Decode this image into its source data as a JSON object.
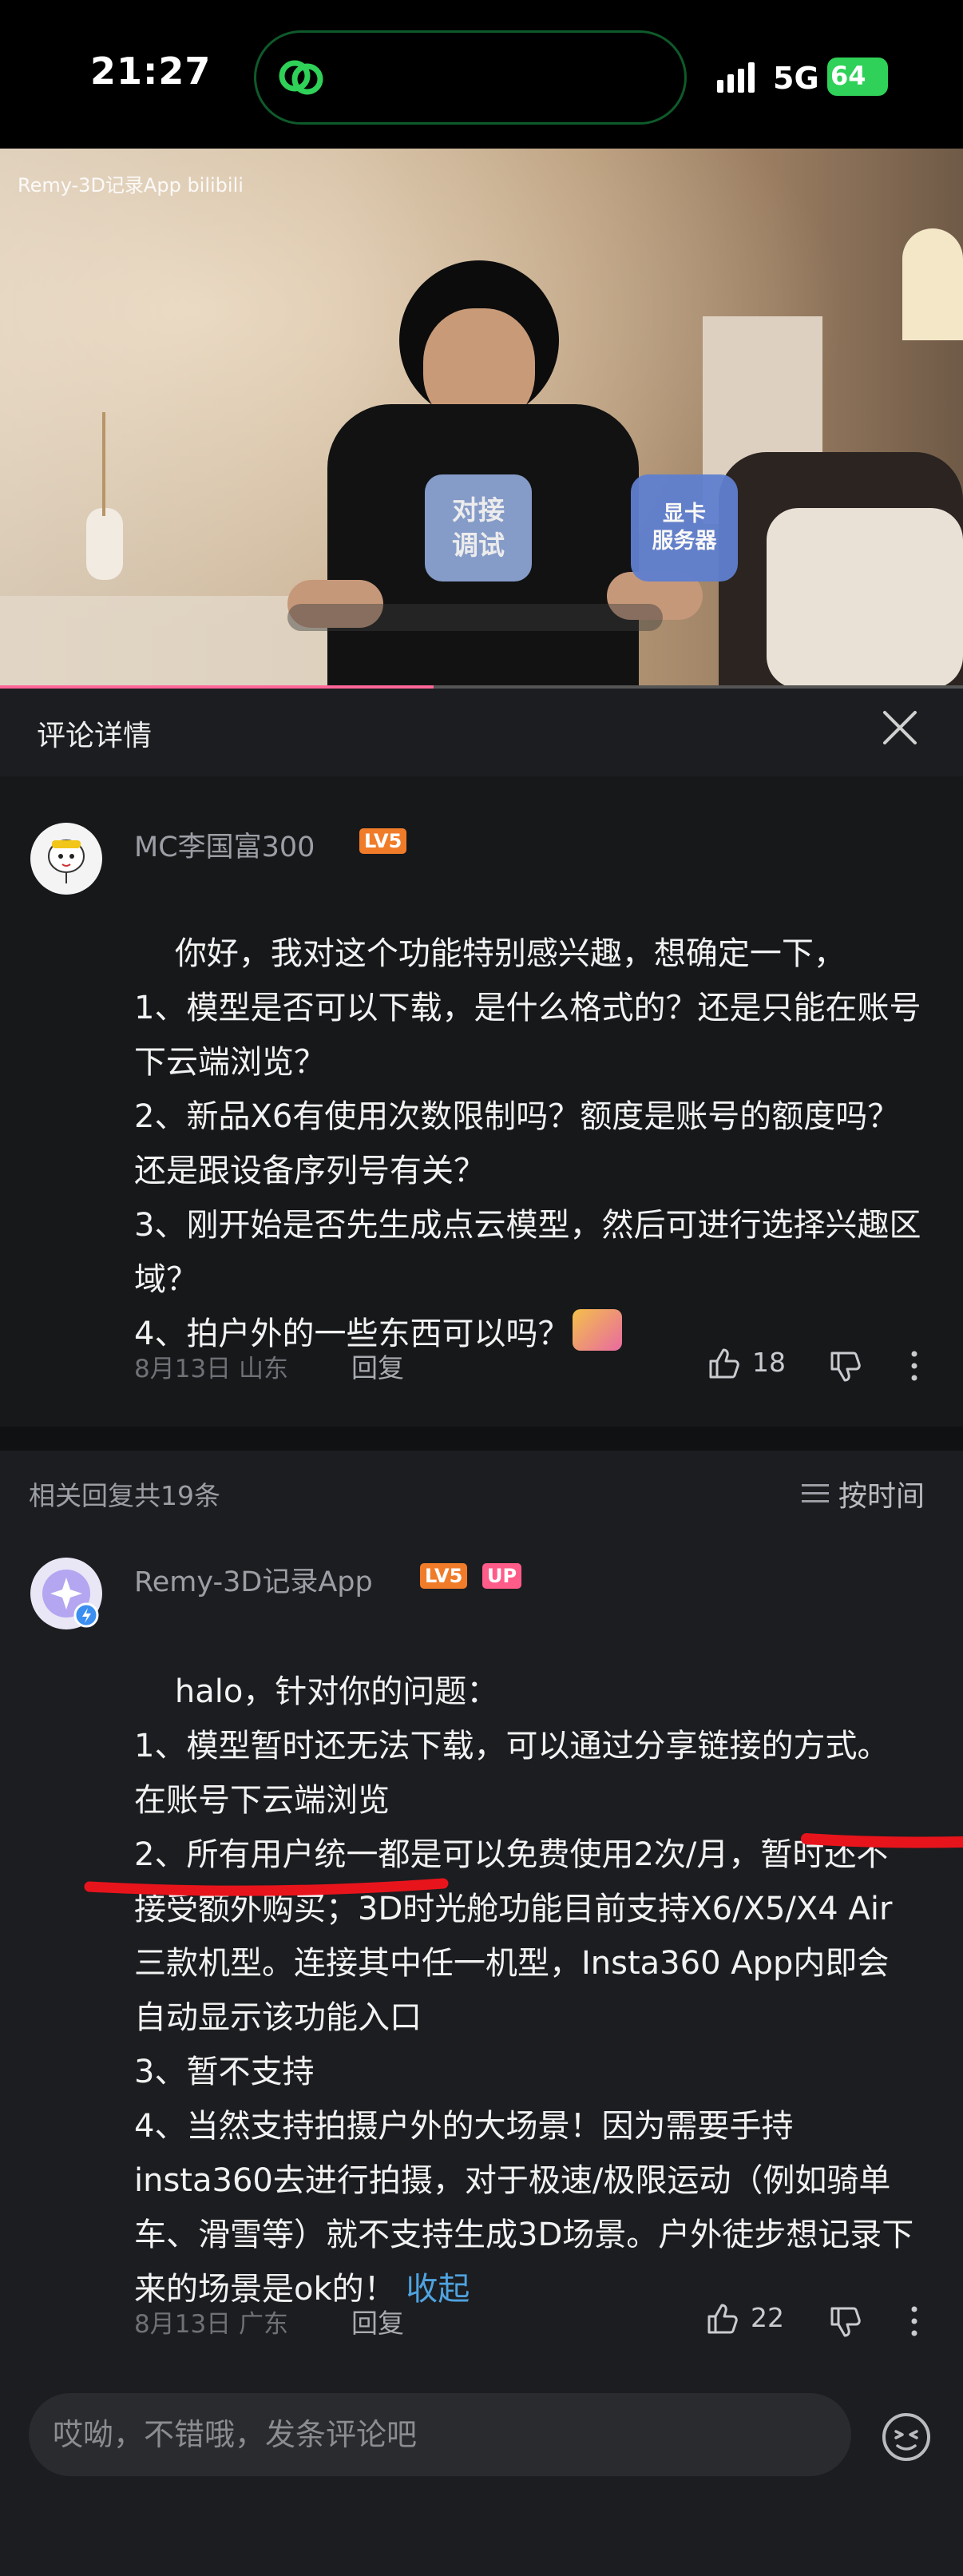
{
  "status": {
    "time": "21:27",
    "network": "5G",
    "battery": "64"
  },
  "video": {
    "watermark": "Remy-3D记录App bilibili",
    "chip1": "对接\n调试",
    "chip2": "显卡\n服务器",
    "progress_percent": 45
  },
  "panel": {
    "title": "评论详情"
  },
  "comment": {
    "username": "MC李国富300",
    "level": "LV5",
    "text": "你好，我对这个功能特别感兴趣，想确定一下，\n1、模型是否可以下载，是什么格式的？还是只能在账号下云端浏览？\n2、新品X6有使用次数限制吗？额度是账号的额度吗？还是跟设备序列号有关？\n3、刚开始是否先生成点云模型，然后可进行选择兴趣区域？\n4、拍户外的一些东西可以吗？",
    "date": "8月13日 山东",
    "reply_label": "回复",
    "likes": "18"
  },
  "replies_header": {
    "count_label": "相关回复共19条",
    "sort_label": "按时间"
  },
  "reply": {
    "username": "Remy-3D记录App",
    "level": "LV5",
    "up_badge": "UP",
    "text": "halo，针对你的问题：\n1、模型暂时还无法下载，可以通过分享链接的方式。在账号下云端浏览\n2、所有用户统一都是可以免费使用2次/月，暂时还不接受额外购买；3D时光舱功能目前支持X6/X5/X4 Air三款机型。连接其中任一机型，Insta360 App内即会自动显示该功能入口\n3、暂不支持\n4、当然支持拍摄户外的大场景！因为需要手持insta360去进行拍摄，对于极速/极限运动（例如骑单车、滑雪等）就不支持生成3D场景。户外徒步想记录下来的场景是ok的！",
    "collapse_label": "收起",
    "date": "8月13日 广东",
    "reply_label": "回复",
    "likes": "22"
  },
  "input": {
    "placeholder": "哎呦，不错哦，发条评论吧"
  },
  "colors": {
    "accent": "#ff6699",
    "link": "#4fa3e0",
    "level_badge": "#f07c2a",
    "up_badge": "#ff5c8a",
    "annotation": "#e8141c"
  }
}
